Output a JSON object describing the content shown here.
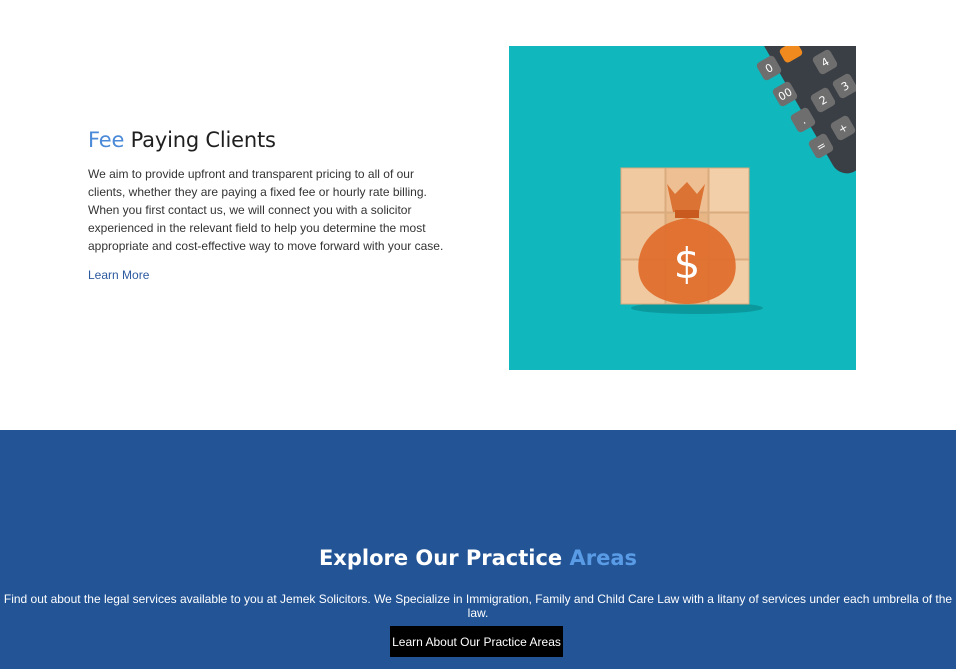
{
  "fee_section": {
    "title_accent": "Fee",
    "title_rest": "Paying Clients",
    "body": "We aim to provide upfront and transparent pricing to all of our clients, whether they are paying a fixed fee or hourly rate billing. When you first contact us, we will connect you with a solicitor experienced in the relevant field to help you determine the most appropriate and cost-effective way to move forward with your case.",
    "link_label": "Learn More",
    "image": {
      "icon": "money-bag-icon",
      "background_color": "#10b7bd",
      "calculator_keys": [
        "0",
        "4",
        "00",
        "2",
        "3",
        ".",
        "=",
        "+"
      ]
    }
  },
  "practice_section": {
    "title_main": "Explore Our Practice",
    "title_accent": "Areas",
    "description": "Find out about the legal services available to you at Jemek Solicitors. We Specialize in Immigration, Family and Child Care Law with a litany of services under each umbrella of the law.",
    "button_label": "Learn About Our Practice Areas",
    "background_color": "#225496"
  }
}
